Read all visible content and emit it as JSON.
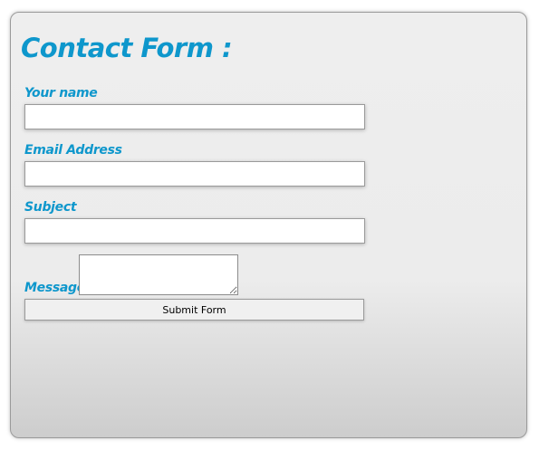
{
  "form": {
    "title": "Contact Form :",
    "fields": [
      {
        "label": "Your name",
        "value": ""
      },
      {
        "label": "Email Address",
        "value": ""
      },
      {
        "label": "Subject",
        "value": ""
      },
      {
        "label": "Message",
        "value": ""
      }
    ],
    "submit_label": "Submit Form",
    "accent_color": "#0e97cc"
  }
}
